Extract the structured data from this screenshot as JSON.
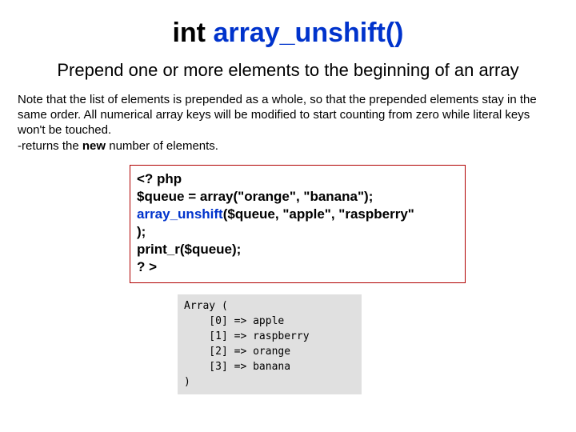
{
  "title": {
    "prefix": "int ",
    "func": "array_unshift()"
  },
  "subtitle": "Prepend one or more elements to the beginning of an array",
  "note": {
    "line1": "Note that the list of elements is prepended as a whole, so that the prepended elements stay in the same order. All numerical array keys will be modified to start counting from zero while literal keys won't be touched.",
    "line2_prefix": "-returns the ",
    "line2_bold": "new",
    "line2_suffix": " number of elements."
  },
  "code": {
    "l1": "<? php",
    "l2": "$queue = array(\"orange\", \"banana\");",
    "l3_fn": "array_unshift",
    "l3_rest": "($queue, \"apple\", \"raspberry\"",
    "l4": ");",
    "l5": "print_r($queue);",
    "l6": "? >"
  },
  "output": {
    "l1": "Array (",
    "l2": "    [0] => apple",
    "l3": "    [1] => raspberry",
    "l4": "    [2] => orange",
    "l5": "    [3] => banana",
    "l6": ")"
  }
}
